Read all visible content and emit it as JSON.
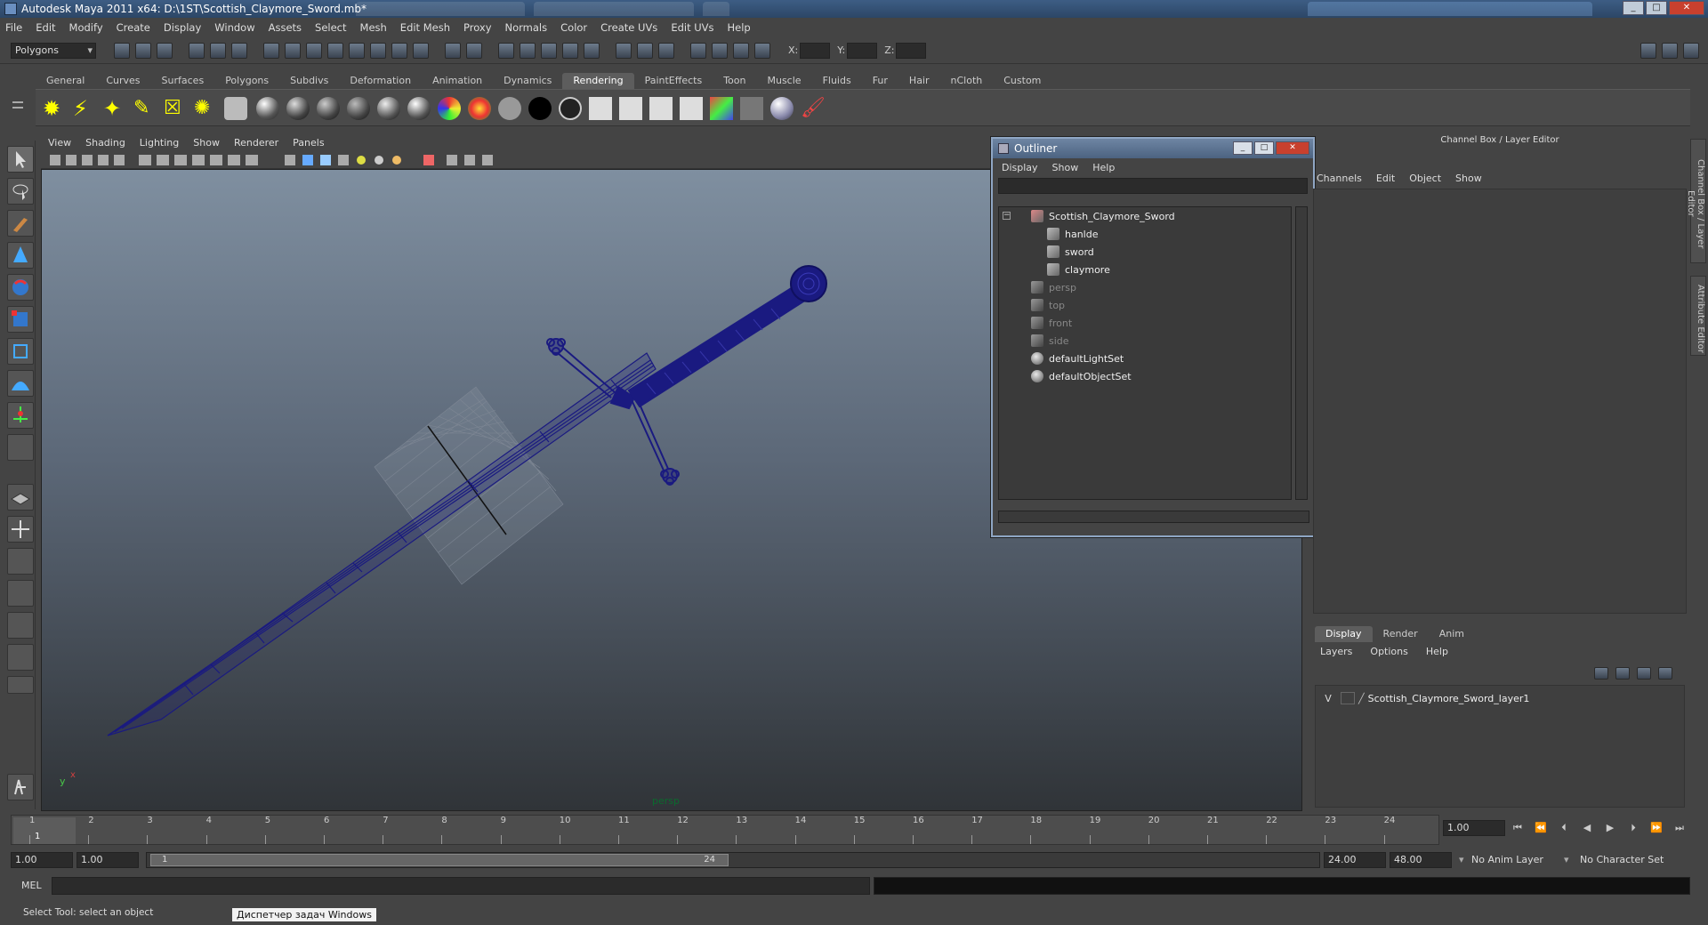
{
  "window": {
    "title": "Autodesk Maya 2011 x64: D:\\1ST\\Scottish_Claymore_Sword.mb*"
  },
  "menubar": [
    "File",
    "Edit",
    "Modify",
    "Create",
    "Display",
    "Window",
    "Assets",
    "Select",
    "Mesh",
    "Edit Mesh",
    "Proxy",
    "Normals",
    "Color",
    "Create UVs",
    "Edit UVs",
    "Help"
  ],
  "statusline": {
    "mode": "Polygons",
    "x_label": "X:",
    "y_label": "Y:",
    "z_label": "Z:"
  },
  "shelf": {
    "tabs": [
      "General",
      "Curves",
      "Surfaces",
      "Polygons",
      "Subdivs",
      "Deformation",
      "Animation",
      "Dynamics",
      "Rendering",
      "PaintEffects",
      "Toon",
      "Muscle",
      "Fluids",
      "Fur",
      "Hair",
      "nCloth",
      "Custom"
    ],
    "active_tab": "Rendering"
  },
  "viewport": {
    "menu": [
      "View",
      "Shading",
      "Lighting",
      "Show",
      "Renderer",
      "Panels"
    ],
    "camera_label": "persp",
    "axis_x": "x",
    "axis_y": "y",
    "mesh_color": "#1a1a80"
  },
  "outliner": {
    "title": "Outliner",
    "menu": [
      "Display",
      "Show",
      "Help"
    ],
    "items": [
      {
        "label": "Scottish_Claymore_Sword",
        "icon": "group-icon",
        "indent": 0,
        "dim": false
      },
      {
        "label": "hanlde",
        "icon": "mesh-icon",
        "indent": 1,
        "dim": false
      },
      {
        "label": "sword",
        "icon": "mesh-icon",
        "indent": 1,
        "dim": false
      },
      {
        "label": "claymore",
        "icon": "mesh-icon",
        "indent": 1,
        "dim": false
      },
      {
        "label": "persp",
        "icon": "camera-icon",
        "indent": 0,
        "dim": true
      },
      {
        "label": "top",
        "icon": "camera-icon",
        "indent": 0,
        "dim": true
      },
      {
        "label": "front",
        "icon": "camera-icon",
        "indent": 0,
        "dim": true
      },
      {
        "label": "side",
        "icon": "camera-icon",
        "indent": 0,
        "dim": true
      },
      {
        "label": "defaultLightSet",
        "icon": "set-icon",
        "indent": 0,
        "dim": false
      },
      {
        "label": "defaultObjectSet",
        "icon": "set-icon",
        "indent": 0,
        "dim": false
      }
    ]
  },
  "channel_box": {
    "header": "Channel Box / Layer Editor",
    "menu": [
      "Channels",
      "Edit",
      "Object",
      "Show"
    ],
    "side_tabs": [
      "Channel Box / Layer Editor",
      "Attribute Editor"
    ]
  },
  "layer_editor": {
    "tabs": [
      "Display",
      "Render",
      "Anim"
    ],
    "active_tab": "Display",
    "menu": [
      "Layers",
      "Options",
      "Help"
    ],
    "layers": [
      {
        "visible": "V",
        "name": "Scottish_Claymore_Sword_layer1"
      }
    ]
  },
  "timeline": {
    "ticks": [
      "1",
      "2",
      "3",
      "4",
      "5",
      "6",
      "7",
      "8",
      "9",
      "10",
      "11",
      "12",
      "13",
      "14",
      "15",
      "16",
      "17",
      "18",
      "19",
      "20",
      "21",
      "22",
      "23",
      "24"
    ],
    "current_frame": "1",
    "current_time": "1.00"
  },
  "range": {
    "start_time": "1.00",
    "playback_start": "1.00",
    "slider_start": "1",
    "slider_end": "24",
    "playback_end": "24.00",
    "end_time": "48.00",
    "anim_layer": "No Anim Layer",
    "character_set": "No Character Set"
  },
  "command_line": {
    "label": "MEL"
  },
  "help_line": {
    "text": "Select Tool: select an object",
    "tooltip": "Диспетчер задач Windows"
  }
}
